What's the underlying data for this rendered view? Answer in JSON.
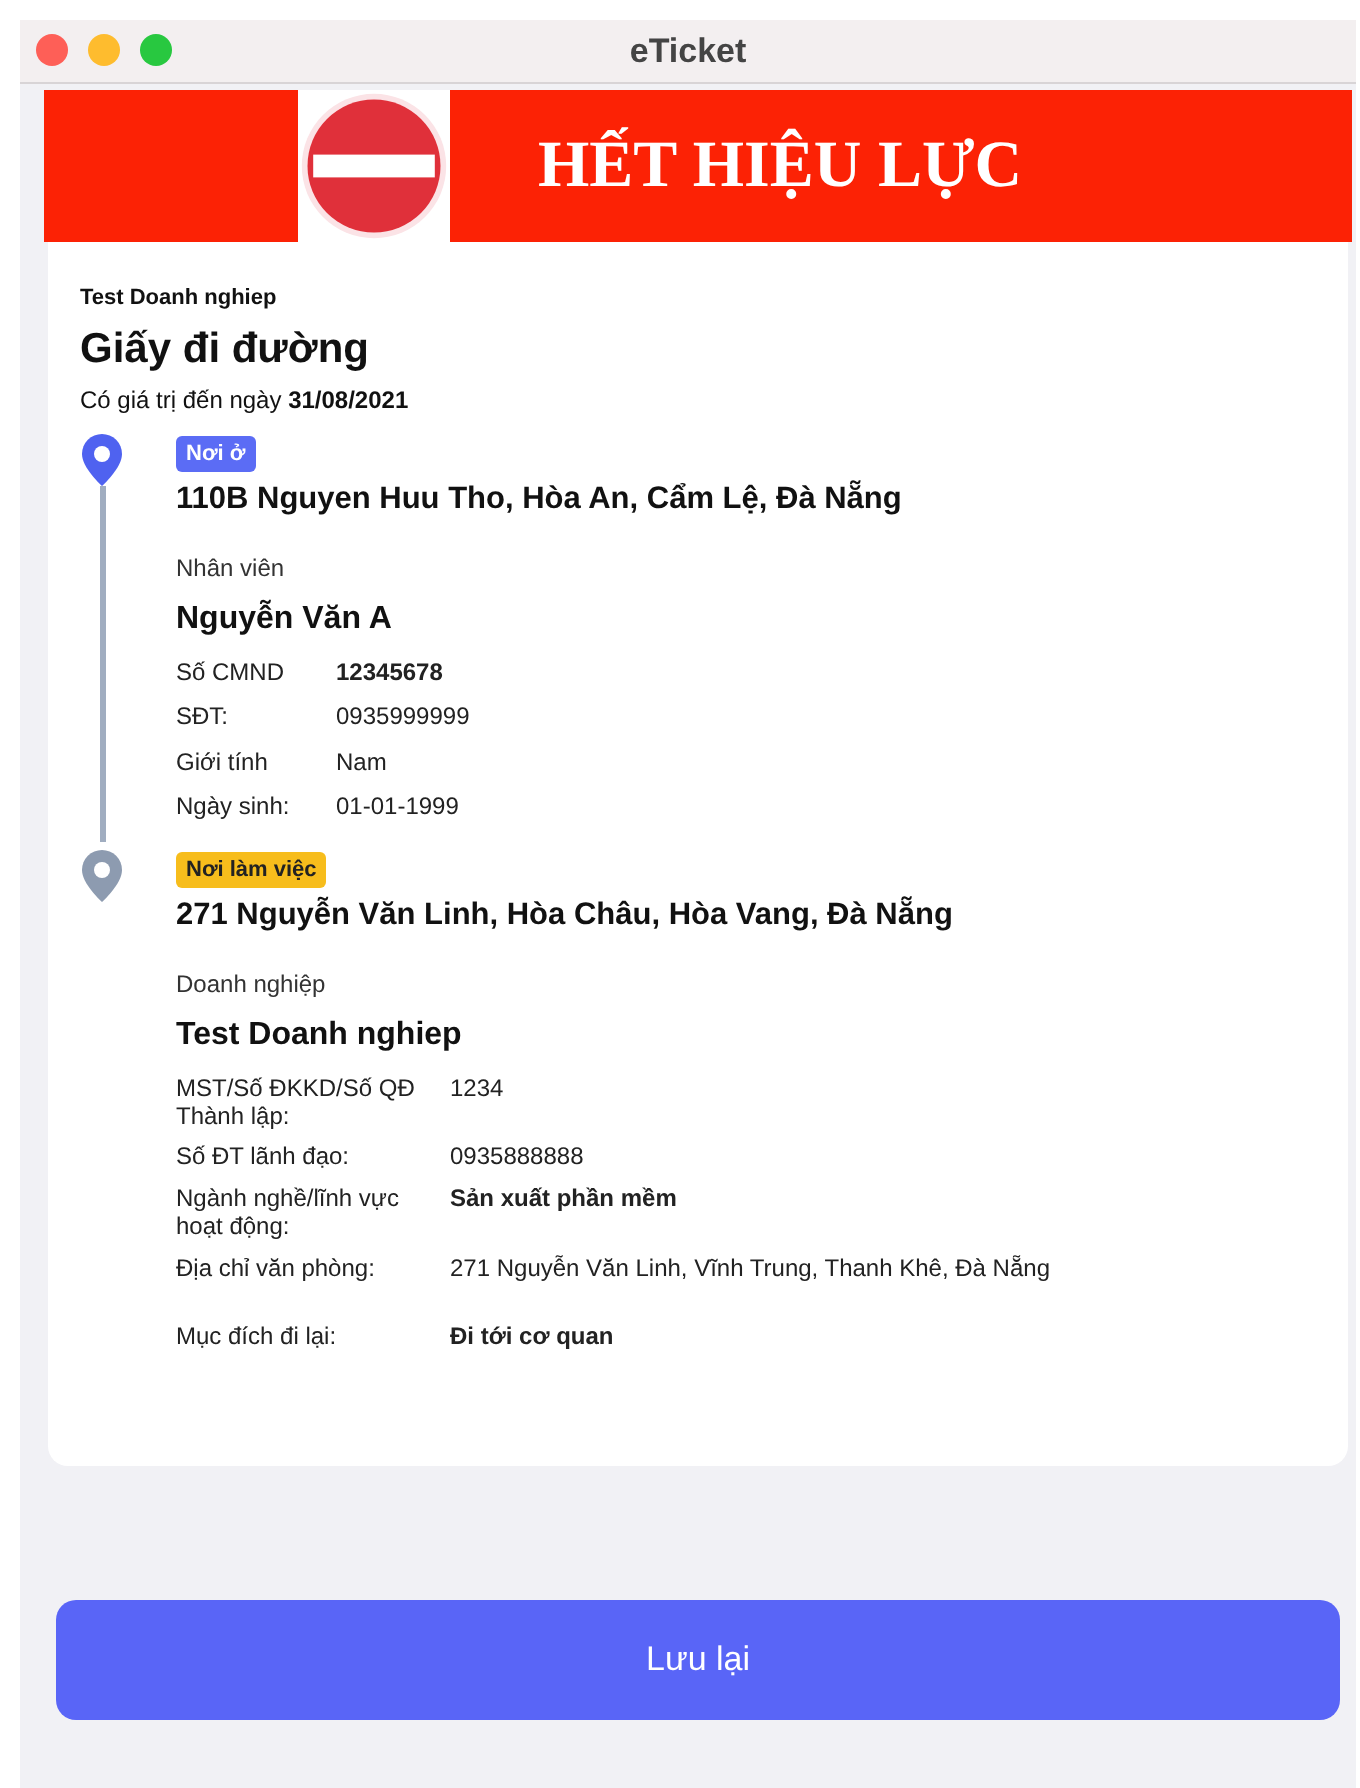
{
  "window": {
    "title": "eTicket"
  },
  "banner": {
    "text": "HẾT HIỆU LỰC"
  },
  "ticket": {
    "company": "Test Doanh nghiep",
    "title": "Giấy đi đường",
    "validity": "Có giá trị đến ngày **31/08/2021**"
  },
  "stops": [
    {
      "active": true,
      "tag": "Nơi ở",
      "color": "#5b6cf5",
      "address": "110B Nguyen Huu Tho, Hòa An, Cẩm Lệ, Đà Nẵng",
      "section_label": "Nhân viên",
      "name": "Nguyễn Văn A",
      "rows": [
        {
          "label": "Số CMND",
          "value": "12345678",
          "bold": true
        },
        {
          "label": "SĐT:",
          "value": "0935999999",
          "bold": false
        },
        {
          "label": "Giới tính",
          "value": "Nam",
          "bold": false
        },
        {
          "label": "Ngày sinh:",
          "value": "01-01-1999",
          "bold": false
        }
      ]
    },
    {
      "active": false,
      "tag": "Nơi làm việc",
      "color": "#f7bd1c",
      "address": "271 Nguyễn Văn Linh, Hòa Châu, Hòa Vang, Đà Nẵng",
      "section_label": "Doanh nghiệp",
      "name": "Test Doanh nghiep",
      "rows": [
        {
          "label": "MST/Số ĐKKD/Số QĐ Thành lập:",
          "value": "1234",
          "bold": false
        },
        {
          "label": "Số ĐT lãnh đạo:",
          "value": "0935888888",
          "bold": false
        },
        {
          "label": "Ngành nghề/lĩnh vực hoạt động:",
          "value": "Sản xuất phần mềm",
          "bold": true
        },
        {
          "label": "Địa chỉ văn phòng:",
          "value": "271 Nguyễn Văn Linh, Vĩnh Trung, Thanh Khê, Đà Nẵng",
          "bold": false
        }
      ]
    }
  ],
  "purpose": {
    "label": "Mục đích đi lại:",
    "value": "Đi tới cơ quan",
    "bold": true
  },
  "save_button": "Lưu lại"
}
